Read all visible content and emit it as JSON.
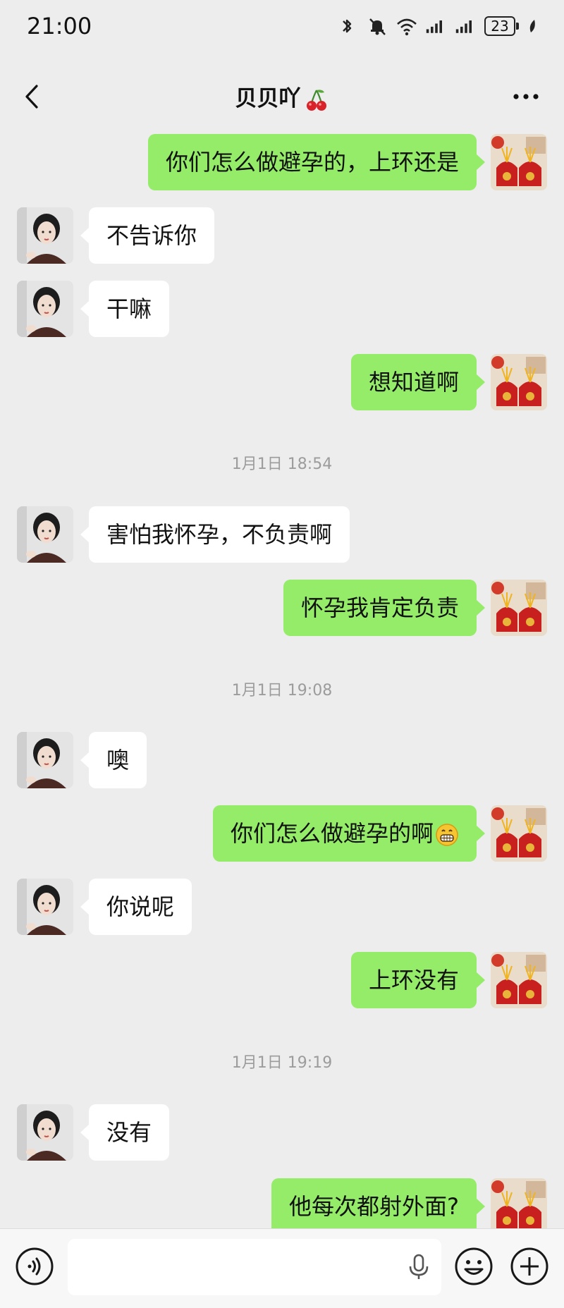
{
  "status_bar": {
    "time": "21:00",
    "battery": "23"
  },
  "header": {
    "title": "贝贝吖"
  },
  "messages": [
    {
      "side": "right",
      "text": "你们怎么做避孕的，上环还是"
    },
    {
      "side": "left",
      "text": "不告诉你"
    },
    {
      "side": "left",
      "text": "干嘛"
    },
    {
      "side": "right",
      "text": "想知道啊"
    },
    {
      "type": "time",
      "text": "1月1日 18:54"
    },
    {
      "side": "left",
      "text": "害怕我怀孕，不负责啊"
    },
    {
      "side": "right",
      "text": "怀孕我肯定负责"
    },
    {
      "type": "time",
      "text": "1月1日 19:08"
    },
    {
      "side": "left",
      "text": "噢"
    },
    {
      "side": "right",
      "text": "你们怎么做避孕的啊",
      "emoji": "grinning-face-emoji"
    },
    {
      "side": "left",
      "text": "你说呢"
    },
    {
      "side": "right",
      "text": "上环没有"
    },
    {
      "type": "time",
      "text": "1月1日 19:19"
    },
    {
      "side": "left",
      "text": "没有"
    },
    {
      "side": "right",
      "text": "他每次都射外面?"
    }
  ],
  "colors": {
    "outgoing_bubble": "#95ec69",
    "incoming_bubble": "#ffffff",
    "background": "#ededed"
  },
  "icons": {
    "back": "chevron-left-icon",
    "more": "more-dots-icon",
    "voice": "voice-wave-icon",
    "mic": "microphone-icon",
    "emoji": "smiley-icon",
    "plus": "plus-circle-icon"
  }
}
